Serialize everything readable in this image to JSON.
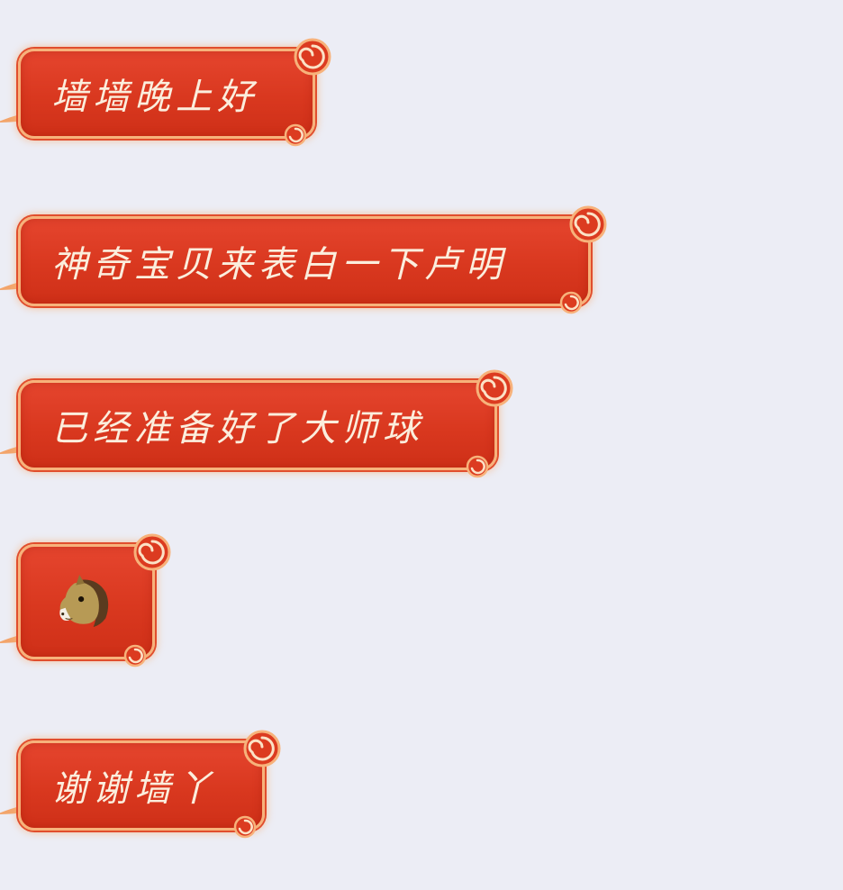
{
  "chat": {
    "messages": [
      {
        "text": "墙墙晚上好"
      },
      {
        "text": "神奇宝贝来表白一下卢明"
      },
      {
        "text": "已经准备好了大师球"
      },
      {
        "emoji": "horse-face-icon"
      },
      {
        "text": "谢谢墙丫"
      }
    ]
  },
  "colors": {
    "background": "#ecedf5",
    "bubble_fill": "#d9381f",
    "bubble_border": "#f7b27b",
    "text": "#fbeedd"
  }
}
